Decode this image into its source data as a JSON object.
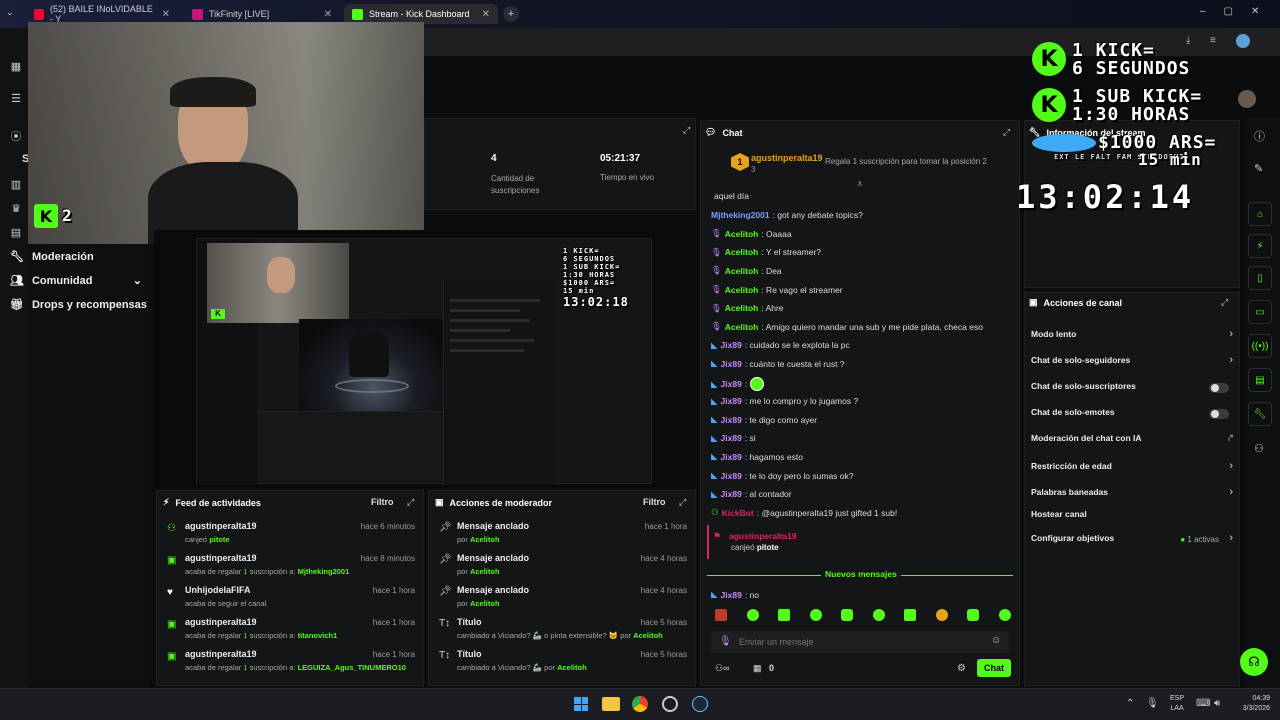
{
  "tabs": [
    {
      "title": "(52) BAILE INoLVIDABLE - Y",
      "color": "#ff0033"
    },
    {
      "title": "TikFinity [LIVE]",
      "color": "#c9147c"
    },
    {
      "title": "Stream - Kick Dashboard",
      "color": "#53fc18"
    }
  ],
  "nav": {
    "items": [
      "Moderación",
      "Comunidad",
      "Drops y recompensas"
    ],
    "partial_letter": "S",
    "badge_number": "2"
  },
  "stats": [
    {
      "value": "4",
      "label": "Cantidad de suscripciones"
    },
    {
      "value": "05:21:37",
      "label": "Tiempo en vivo"
    }
  ],
  "chat": {
    "title": "Chat",
    "pinned_user": "agustinperalta19",
    "pinned_count": "3",
    "pinned_note": "Regala 1 suscripción para tomar la posición 2",
    "lines": [
      {
        "user": "",
        "text": "aquel día",
        "color": "#ddd"
      },
      {
        "user": "Mjtheking2001",
        "text": ": got any debate topics?",
        "color": "#7aa2ff"
      },
      {
        "user": "Acelitoh",
        "text": ": Oaaaa",
        "color": "#53fc18"
      },
      {
        "user": "Acelitoh",
        "text": ": Y el streamer?",
        "color": "#53fc18"
      },
      {
        "user": "Acelitoh",
        "text": ": Dea",
        "color": "#53fc18"
      },
      {
        "user": "Acelitoh",
        "text": ": Re vago el streamer",
        "color": "#53fc18"
      },
      {
        "user": "Acelitoh",
        "text": ": Ahre",
        "color": "#53fc18"
      },
      {
        "user": "Acelitoh",
        "text": ": Amigo quiero mandar una sub y me pide plata, checa eso",
        "color": "#53fc18"
      },
      {
        "user": "Jix89",
        "text": ": cuidado se le explota la pc",
        "color": "#c88bff"
      },
      {
        "user": "Jix89",
        "text": ": cuánto te cuesta el rust ?",
        "color": "#c88bff"
      },
      {
        "user": "Jix89",
        "text": ":",
        "color": "#c88bff"
      },
      {
        "user": "Jix89",
        "text": ": me lo compro y lo jugamos ?",
        "color": "#c88bff"
      },
      {
        "user": "Jix89",
        "text": ": te digo como ayer",
        "color": "#c88bff"
      },
      {
        "user": "Jix89",
        "text": ": si",
        "color": "#c88bff"
      },
      {
        "user": "Jix89",
        "text": ": hagamos esto",
        "color": "#c88bff"
      },
      {
        "user": "Jix89",
        "text": ": te lo doy pero lo sumas ok?",
        "color": "#c88bff"
      },
      {
        "user": "Jix89",
        "text": ": al contador",
        "color": "#c88bff"
      },
      {
        "user": "KickBot",
        "text": ": @agustinperalta19 just gifted 1 sub!",
        "color": "#e0245e"
      }
    ],
    "redeem_user": "agustinperalta19",
    "redeem_prefix": "canjeó",
    "redeem_item": "pitote",
    "new_messages": "Nuevos mensajes",
    "last_user": "Jix89",
    "last_text": ": no",
    "input_placeholder": "Enviar un mensaje",
    "viewer_count": "0",
    "send_label": "Chat"
  },
  "feed": {
    "title": "Feed de actividades",
    "filter": "Filtro",
    "items": [
      {
        "user": "agustinperalta19",
        "time": "hace 6 minutos",
        "pre": "canjeó ",
        "num": "",
        "mid": "",
        "target": "pitote"
      },
      {
        "user": "agustinperalta19",
        "time": "hace 8 minutos",
        "pre": "acaba de regalar ",
        "num": "1",
        "mid": " suscripción a: ",
        "target": "Mjtheking2001"
      },
      {
        "user": "UnhijodelaFIFA",
        "time": "hace 1 hora",
        "pre": "acaba de seguir el canal",
        "num": "",
        "mid": "",
        "target": ""
      },
      {
        "user": "agustinperalta19",
        "time": "hace 1 hora",
        "pre": "acaba de regalar ",
        "num": "1",
        "mid": " suscripción a: ",
        "target": "titanovich1"
      },
      {
        "user": "agustinperalta19",
        "time": "hace 1 hora",
        "pre": "acaba de regalar ",
        "num": "1",
        "mid": " suscripción a: ",
        "target": "LEGUIZA_Agus_TINUMERO10"
      }
    ]
  },
  "mod": {
    "title": "Acciones de moderador",
    "filter": "Filtro",
    "items": [
      {
        "title": "Mensaje anclado",
        "time": "hace 1 hora",
        "sub": "por ",
        "by": "Acelitoh"
      },
      {
        "title": "Mensaje anclado",
        "time": "hace 4 horas",
        "sub": "por ",
        "by": "Acelitoh"
      },
      {
        "title": "Mensaje anclado",
        "time": "hace 4 horas",
        "sub": "por ",
        "by": "Acelitoh"
      },
      {
        "title": "Título",
        "time": "hace 5 horas",
        "sub": "cambiado a Viciando? 🦾 o pinta extensible? 🐱 por ",
        "by": "Acelitoh"
      },
      {
        "title": "Título",
        "time": "hace 5 horas",
        "sub": "cambiado a Viciando? 🦾 por ",
        "by": "Acelitoh"
      }
    ]
  },
  "stream_info": {
    "title": "Información del stream"
  },
  "channel_actions": {
    "title": "Acciones de canal",
    "items": [
      {
        "label": "Modo lento",
        "control": "chevron"
      },
      {
        "label": "Chat de solo-seguidores",
        "control": "chevron"
      },
      {
        "label": "Chat de solo-suscriptores",
        "control": "toggle"
      },
      {
        "label": "Chat de solo-emotes",
        "control": "toggle"
      },
      {
        "label": "Moderación del chat con IA",
        "control": "link"
      },
      {
        "label": "Restricción de edad",
        "control": "chevron"
      },
      {
        "label": "Palabras baneadas",
        "control": "chevron"
      },
      {
        "label": "Hostear canal",
        "control": "none"
      },
      {
        "label": "Configurar objetivos",
        "control": "chevron",
        "extra": "1 activas"
      }
    ]
  },
  "overlay": {
    "line1": "1 KICK=",
    "line2": "6 SEGUNDOS",
    "line3": "1 SUB KICK=",
    "line4": "1:30 HORAS",
    "money": "$1000 ARS=",
    "money_time": "15 min",
    "marquee": "EXT      LE FALT   FAM SIN DORMIR",
    "timer": "13:02:14"
  },
  "nested": {
    "k1": "1 KICK=",
    "k2": "6 SEGUNDOS",
    "k3": "1 SUB KICK=",
    "k4": "1:30 HORAS",
    "money": "$1000 ARS=",
    "money_time": "15 min",
    "timer": "13:02:18"
  },
  "taskbar": {
    "lang1": "ESP",
    "lang2": "LAA",
    "time": "04:39",
    "date": "3/3/2026"
  },
  "colors": {
    "accent": "#53fc18",
    "bg": "#0b0c0d",
    "panel": "#141516"
  }
}
